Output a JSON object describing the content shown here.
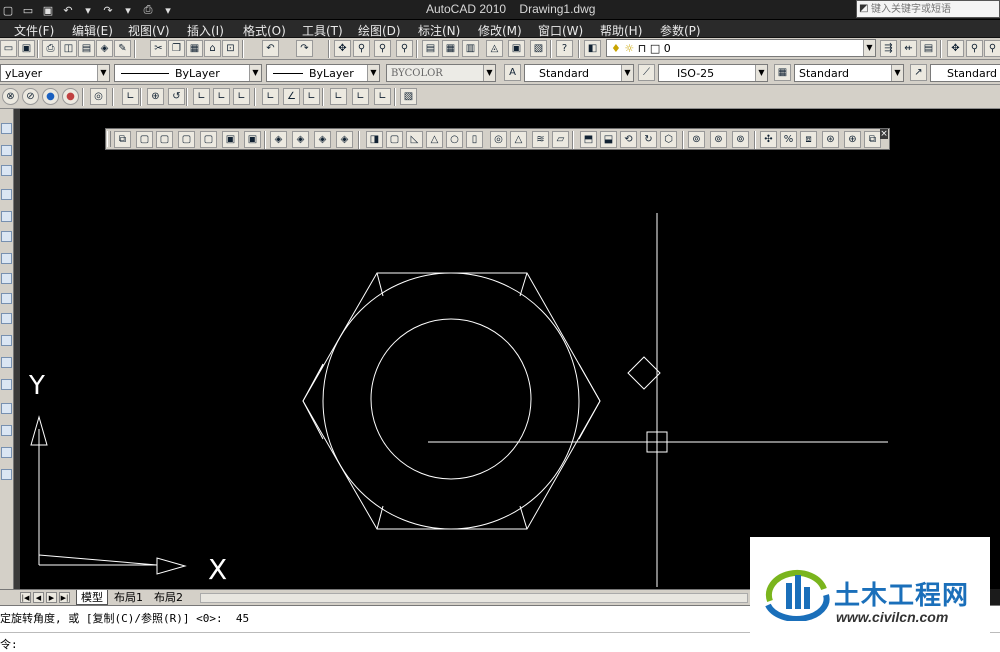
{
  "window": {
    "app_title": "AutoCAD 2010",
    "document_title": "Drawing1.dwg",
    "search_placeholder": "键入关键字或短语"
  },
  "menu": {
    "items": [
      "文件(F)",
      "编辑(E)",
      "视图(V)",
      "插入(I)",
      "格式(O)",
      "工具(T)",
      "绘图(D)",
      "标注(N)",
      "修改(M)",
      "窗口(W)",
      "帮助(H)",
      "参数(P)"
    ]
  },
  "toolbar1": {
    "layer_value": "0"
  },
  "toolbar2": {
    "layer": "yLayer",
    "linetype": "ByLayer",
    "lineweight": "ByLayer",
    "plot_style": "BYCOLOR",
    "text_style": "Standard",
    "dim_style": "ISO-25",
    "table_style": "Standard",
    "multileader_style": "Standard"
  },
  "ucs": {
    "y_label": "Y",
    "x_label": "X"
  },
  "tabs": {
    "model": "模型",
    "layout1": "布局1",
    "layout2": "布局2"
  },
  "command": {
    "history": "定旋转角度, 或 [复制(C)/参照(R)] <0>:  45",
    "prompt": "令:"
  },
  "watermark": {
    "name": "土木工程网",
    "url": "www.civilcn.com"
  },
  "colors": {
    "canvas_bg": "#000000",
    "geometry": "#ffffff",
    "watermark_blue": "#1a6fba",
    "watermark_green": "#7ab51d"
  }
}
